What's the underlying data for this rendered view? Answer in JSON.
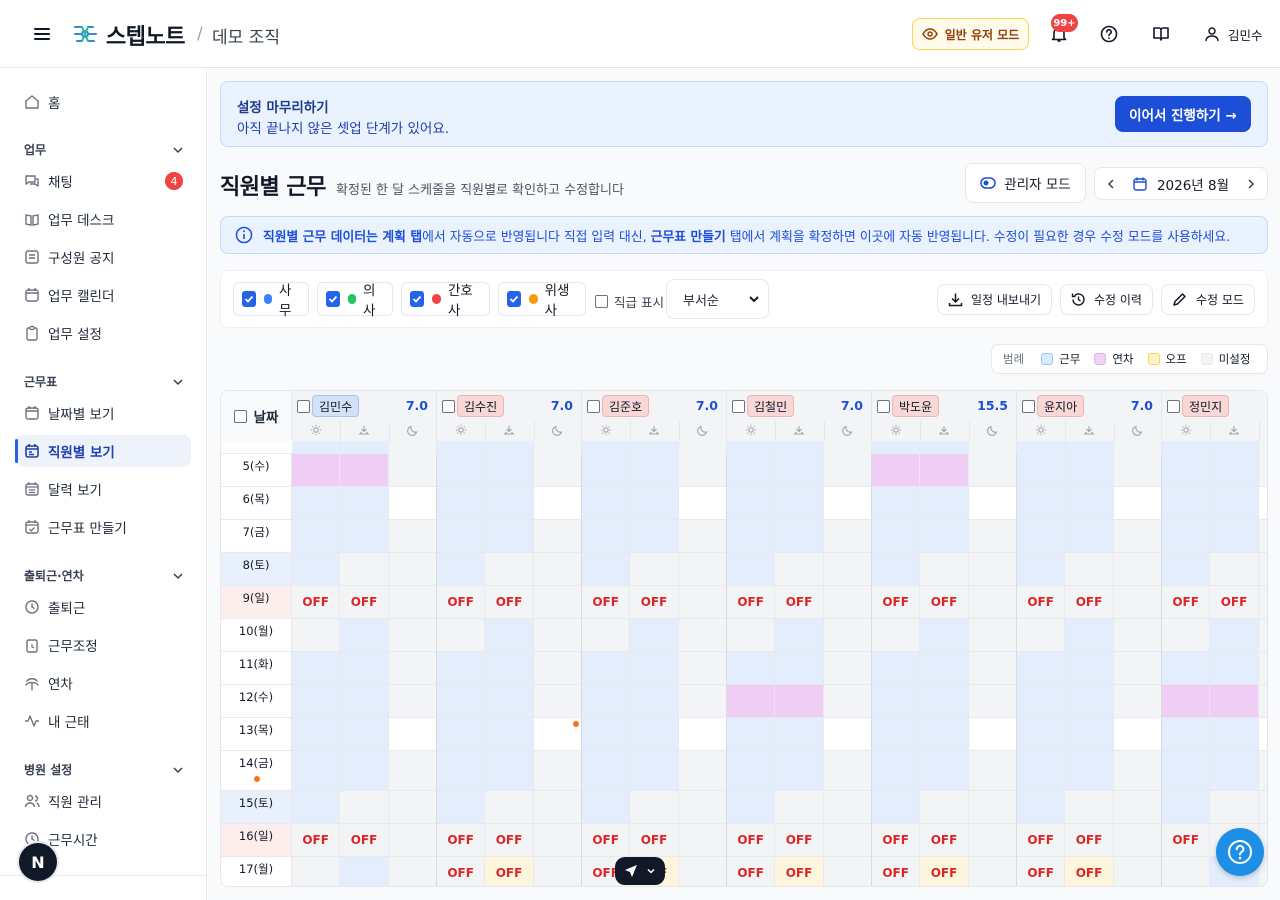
{
  "header": {
    "brand": "스텝노트",
    "separator": "/",
    "org": "데모 조직",
    "mode_button": "일반 유저 모드",
    "notif_badge": "99+",
    "user_name": "김민수"
  },
  "sidebar": {
    "home": "홈",
    "sections": [
      {
        "title": "업무",
        "items": [
          "채팅",
          "업무 데스크",
          "구성원 공지",
          "업무 캘린더",
          "업무 설정"
        ]
      },
      {
        "title": "근무표",
        "items": [
          "날짜별 보기",
          "직원별 보기",
          "달력 보기",
          "근무표 만들기"
        ]
      },
      {
        "title": "출퇴근·연차",
        "items": [
          "출퇴근",
          "근무조정",
          "연차",
          "내 근태"
        ]
      },
      {
        "title": "병원 설정",
        "items": [
          "직원 관리",
          "근무시간"
        ]
      }
    ],
    "chat_badge": "4",
    "avatar_letter": "N"
  },
  "banner": {
    "title": "설정 마무리하기",
    "subtitle": "아직 끝나지 않은 셋업 단계가 있어요.",
    "cta": "이어서 진행하기 →"
  },
  "page": {
    "title": "직원별 근무",
    "subtitle": "확정된 한 달 스케줄을 직원별로 확인하고 수정합니다",
    "admin_mode": "관리자 모드",
    "month": "2026년 8월"
  },
  "info": {
    "part1": "직원별 근무 데이터는 ",
    "bold1": "계획 탭",
    "part2": "에서 자동으로 반영됩니다 직접 입력 대신, ",
    "bold2": "근무표 만들기",
    "part3": " 탭에서 계획을 확정하면 이곳에 자동 반영됩니다. 수정이 필요한 경우 수정 모드를 사용하세요."
  },
  "filters": {
    "roles": [
      {
        "label": "사무",
        "color": "#3b82f6"
      },
      {
        "label": "의사",
        "color": "#22c55e"
      },
      {
        "label": "간호사",
        "color": "#ef4444"
      },
      {
        "label": "위생사",
        "color": "#f59e0b"
      }
    ],
    "show_rank": "직급 표시",
    "sort": "부서순",
    "export": "일정 내보내기",
    "history": "수정 이력",
    "edit_mode": "수정 모드"
  },
  "legend": {
    "label": "범례",
    "items": [
      {
        "label": "근무",
        "color": "#dbeafe"
      },
      {
        "label": "연차",
        "color": "#f0d4f5"
      },
      {
        "label": "오프",
        "color": "#fef3c7"
      },
      {
        "label": "미설정",
        "color": "#f3f4f6"
      }
    ]
  },
  "schedule": {
    "date_header": "날짜",
    "off_label": "OFF",
    "employees": [
      {
        "name": "김민수",
        "hours": "7.0",
        "tag": "#d4e2f7"
      },
      {
        "name": "김수진",
        "hours": "7.0",
        "tag": "#f8d7d7"
      },
      {
        "name": "김준호",
        "hours": "7.0",
        "tag": "#f8d7d7"
      },
      {
        "name": "김철민",
        "hours": "7.0",
        "tag": "#f8d7d7"
      },
      {
        "name": "박도윤",
        "hours": "15.5",
        "tag": "#f8d7d7"
      },
      {
        "name": "윤지아",
        "hours": "7.0",
        "tag": "#f8d7d7"
      },
      {
        "name": "정민지",
        "hours": "",
        "tag": "#f8d7d7"
      }
    ],
    "rows": [
      {
        "date": "5(수)",
        "type": "weekday",
        "leave": [
          0,
          4
        ]
      },
      {
        "date": "6(목)",
        "type": "weekday",
        "white3": true
      },
      {
        "date": "7(금)",
        "type": "weekday"
      },
      {
        "date": "8(토)",
        "type": "sat"
      },
      {
        "date": "9(일)",
        "type": "sun"
      },
      {
        "date": "10(월)",
        "type": "mon"
      },
      {
        "date": "11(화)",
        "type": "weekday"
      },
      {
        "date": "12(수)",
        "type": "weekday",
        "leave": [
          3,
          6
        ]
      },
      {
        "date": "13(목)",
        "type": "weekday",
        "white3": true
      },
      {
        "date": "14(금)",
        "type": "weekday"
      },
      {
        "date": "15(토)",
        "type": "sat"
      },
      {
        "date": "16(일)",
        "type": "sun"
      },
      {
        "date": "17(월)",
        "type": "sun17"
      }
    ]
  }
}
